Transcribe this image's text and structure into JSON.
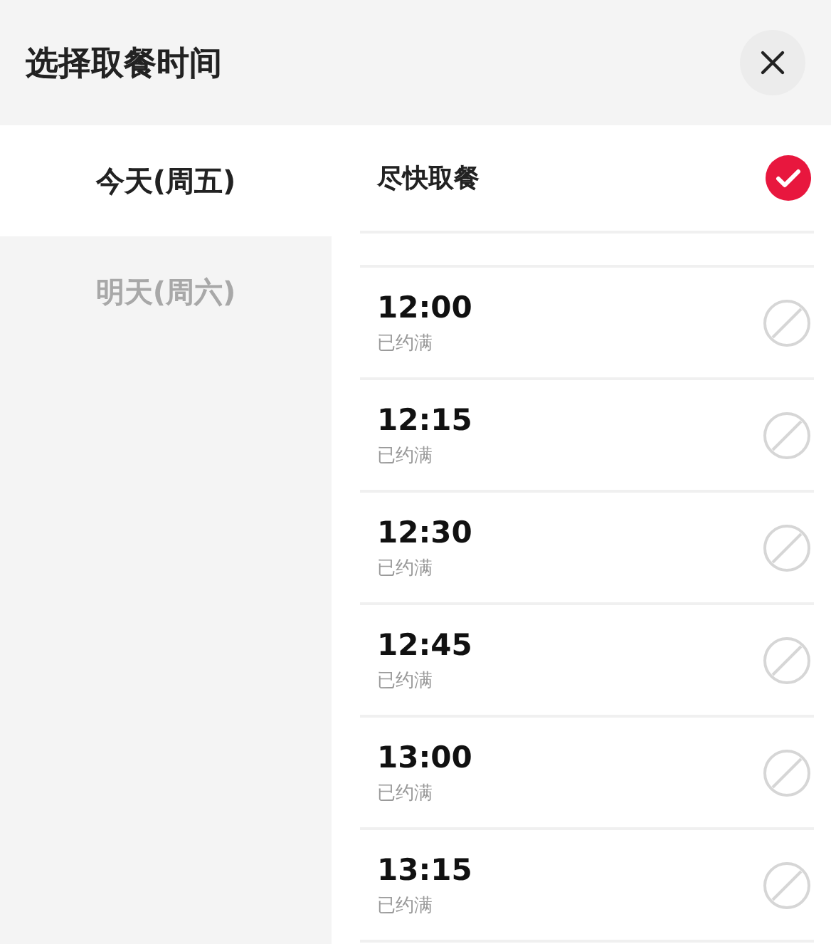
{
  "title": "选择取餐时间",
  "days": [
    {
      "label": "今天(周五)",
      "selected": true
    },
    {
      "label": "明天(周六)",
      "selected": false
    }
  ],
  "options": [
    {
      "kind": "asap",
      "label": "尽快取餐",
      "selected": true
    },
    {
      "kind": "slot",
      "time": "12:00",
      "status": "已约满",
      "selected": false,
      "disabled": true
    },
    {
      "kind": "slot",
      "time": "12:15",
      "status": "已约满",
      "selected": false,
      "disabled": true
    },
    {
      "kind": "slot",
      "time": "12:30",
      "status": "已约满",
      "selected": false,
      "disabled": true
    },
    {
      "kind": "slot",
      "time": "12:45",
      "status": "已约满",
      "selected": false,
      "disabled": true
    },
    {
      "kind": "slot",
      "time": "13:00",
      "status": "已约满",
      "selected": false,
      "disabled": true
    },
    {
      "kind": "slot",
      "time": "13:15",
      "status": "已约满",
      "selected": false,
      "disabled": true
    }
  ]
}
